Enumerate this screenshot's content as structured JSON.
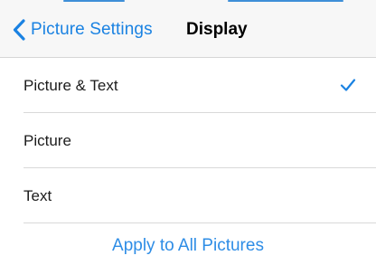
{
  "navbar": {
    "back_label": "Picture Settings",
    "title": "Display"
  },
  "options": [
    {
      "label": "Picture & Text",
      "selected": true
    },
    {
      "label": "Picture",
      "selected": false
    },
    {
      "label": "Text",
      "selected": false
    }
  ],
  "apply_label": "Apply to All Pictures",
  "icons": {
    "back": "chevron-left-icon",
    "selected": "checkmark-icon"
  },
  "colors": {
    "accent": "#1a82e2",
    "navbar_bg": "#f7f7f7",
    "divider": "#d9d9d9"
  }
}
